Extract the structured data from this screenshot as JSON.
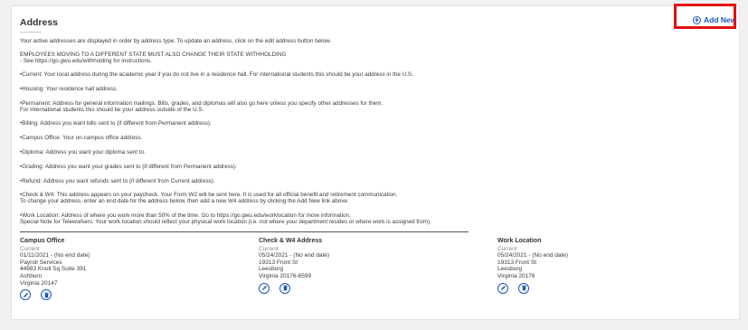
{
  "section": {
    "title": "Address",
    "add_new_label": "Add New"
  },
  "intro": [
    "Your active addresses are displayed in order by address type.  To update an address, click on the edit address button below.",
    "EMPLOYEES MOVING TO A DIFFERENT STATE MUST ALSO CHANGE THEIR STATE WITHHOLDING",
    "- See https://go.gwu.edu/withholding for instructions.",
    "•Current: Your local address during the academic year if you do not live in a residence hall. For international students this should be your address in the U.S.",
    "•Housing: Your residence hall address.",
    "•Permanent: Address for general information mailings. Bills, grades, and diplomas will also go here unless you specify other addresses for them.",
    "For international students this should be your address outside of the U.S.",
    "•Billing: Address you want bills sent to (if different from Permanent address).",
    "•Campus Office: Your on-campus office address.",
    "•Diploma: Address you want your diploma sent to.",
    "•Grading: Address you want your grades sent to (if different from Permanent address).",
    "•Refund: Address you want refunds sent to (if different from Current address).",
    "•Check & W4: This address appears on your paycheck. Your Form W2 will be sent here. It is used for all official benefit and retirement communication.",
    "To change your address, enter an end date for the address below, then add a new W4 address by clicking the Add New link above.",
    "•Work Location: Address of where you work more than 50% of the time. Go to https://go.gwu.edu/worklocation for more information.",
    "Special Note for Teleworkers: Your work location should reflect your physical work location (i.e. not where your department resides or where work is assigned from)."
  ],
  "addresses": [
    {
      "heading": "Campus Office",
      "status": "Current",
      "dates": "01/11/2021 - (No end date)",
      "lines": [
        "Payroll Services",
        "44983 Knoll Sq Suite 391",
        "Ashburn",
        "Virginia 20147"
      ]
    },
    {
      "heading": "Check & W4 Address",
      "status": "Current",
      "dates": "05/24/2021 - (No end date)",
      "lines": [
        "19313 Front St",
        "Leesburg",
        "Virginia 20176-6599"
      ]
    },
    {
      "heading": "Work Location",
      "status": "Current",
      "dates": "05/24/2021 - (No end date)",
      "lines": [
        "19313 Front St",
        "Leesburg",
        "Virginia 20176"
      ]
    }
  ],
  "icons": {
    "add": "plus-circle-icon",
    "edit": "pencil-icon",
    "delete": "trash-icon"
  },
  "colors": {
    "accent": "#1a56b8",
    "highlight": "#e21010"
  }
}
